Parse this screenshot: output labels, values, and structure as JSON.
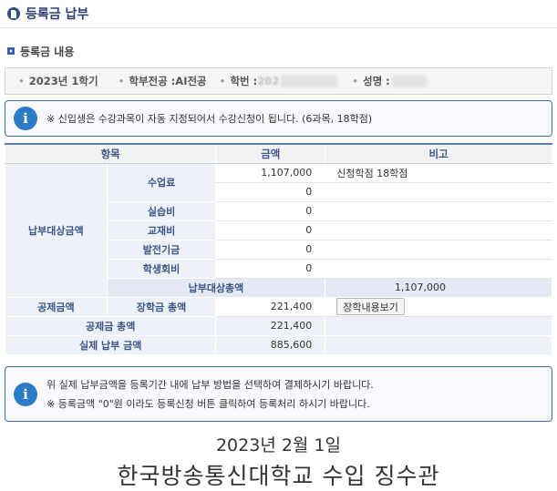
{
  "page": {
    "title": "등록금 납부",
    "section_title": "등록금 내용"
  },
  "student": {
    "term": "2023년 1학기",
    "major_label": "학부전공 : ",
    "major": "AI전공",
    "id_label": "학번 : ",
    "id_visible_prefix": "202",
    "name_label": "성명 : "
  },
  "notice_top": "※ 신입생은 수강과목이 자동 지정되어서 수강신청이 됩니다. (6과목, 18학점)",
  "table": {
    "headers": {
      "item": "항목",
      "amount": "금액",
      "remark": "비고"
    },
    "group_payable": "납부대상금액",
    "rows": [
      {
        "label": "수업료",
        "amount": "1,107,000",
        "remark": "신청학점 18학점"
      },
      {
        "label": "",
        "amount": "0",
        "remark": ""
      },
      {
        "label": "실습비",
        "amount": "0",
        "remark": ""
      },
      {
        "label": "교재비",
        "amount": "0",
        "remark": ""
      },
      {
        "label": "발전기금",
        "amount": "0",
        "remark": ""
      },
      {
        "label": "학생회비",
        "amount": "0",
        "remark": ""
      }
    ],
    "payable_total_label": "납부대상총액",
    "payable_total": "1,107,000",
    "group_deduction": "공제금액",
    "scholarship_label": "장학금 총액",
    "scholarship_amount": "221,400",
    "scholarship_button": "장학내용보기",
    "deduction_total_label": "공제금 총액",
    "deduction_total": "221,400",
    "actual_payment_label": "실제 납부 금액",
    "actual_payment": "885,600"
  },
  "notice_bottom": {
    "line1": "위 실제 납부금액을 등록기간 내에 납부 방법을 선택하여 결제하시기 바랍니다.",
    "line2": "※ 등록금액 \"0\"원 이라도 등록신청 버튼 클릭하여 등록처리 하시기 바랍니다."
  },
  "footer": {
    "date": "2023년 2월 1일",
    "school": "한국방송통신대학교 수입 징수관"
  },
  "icons": {
    "title": "document-icon",
    "section": "arrow-bullet-icon",
    "notice": "info-icon"
  },
  "colors": {
    "accent": "#3b5688",
    "border": "#3b6fb4",
    "info": "#2d7ac7"
  }
}
